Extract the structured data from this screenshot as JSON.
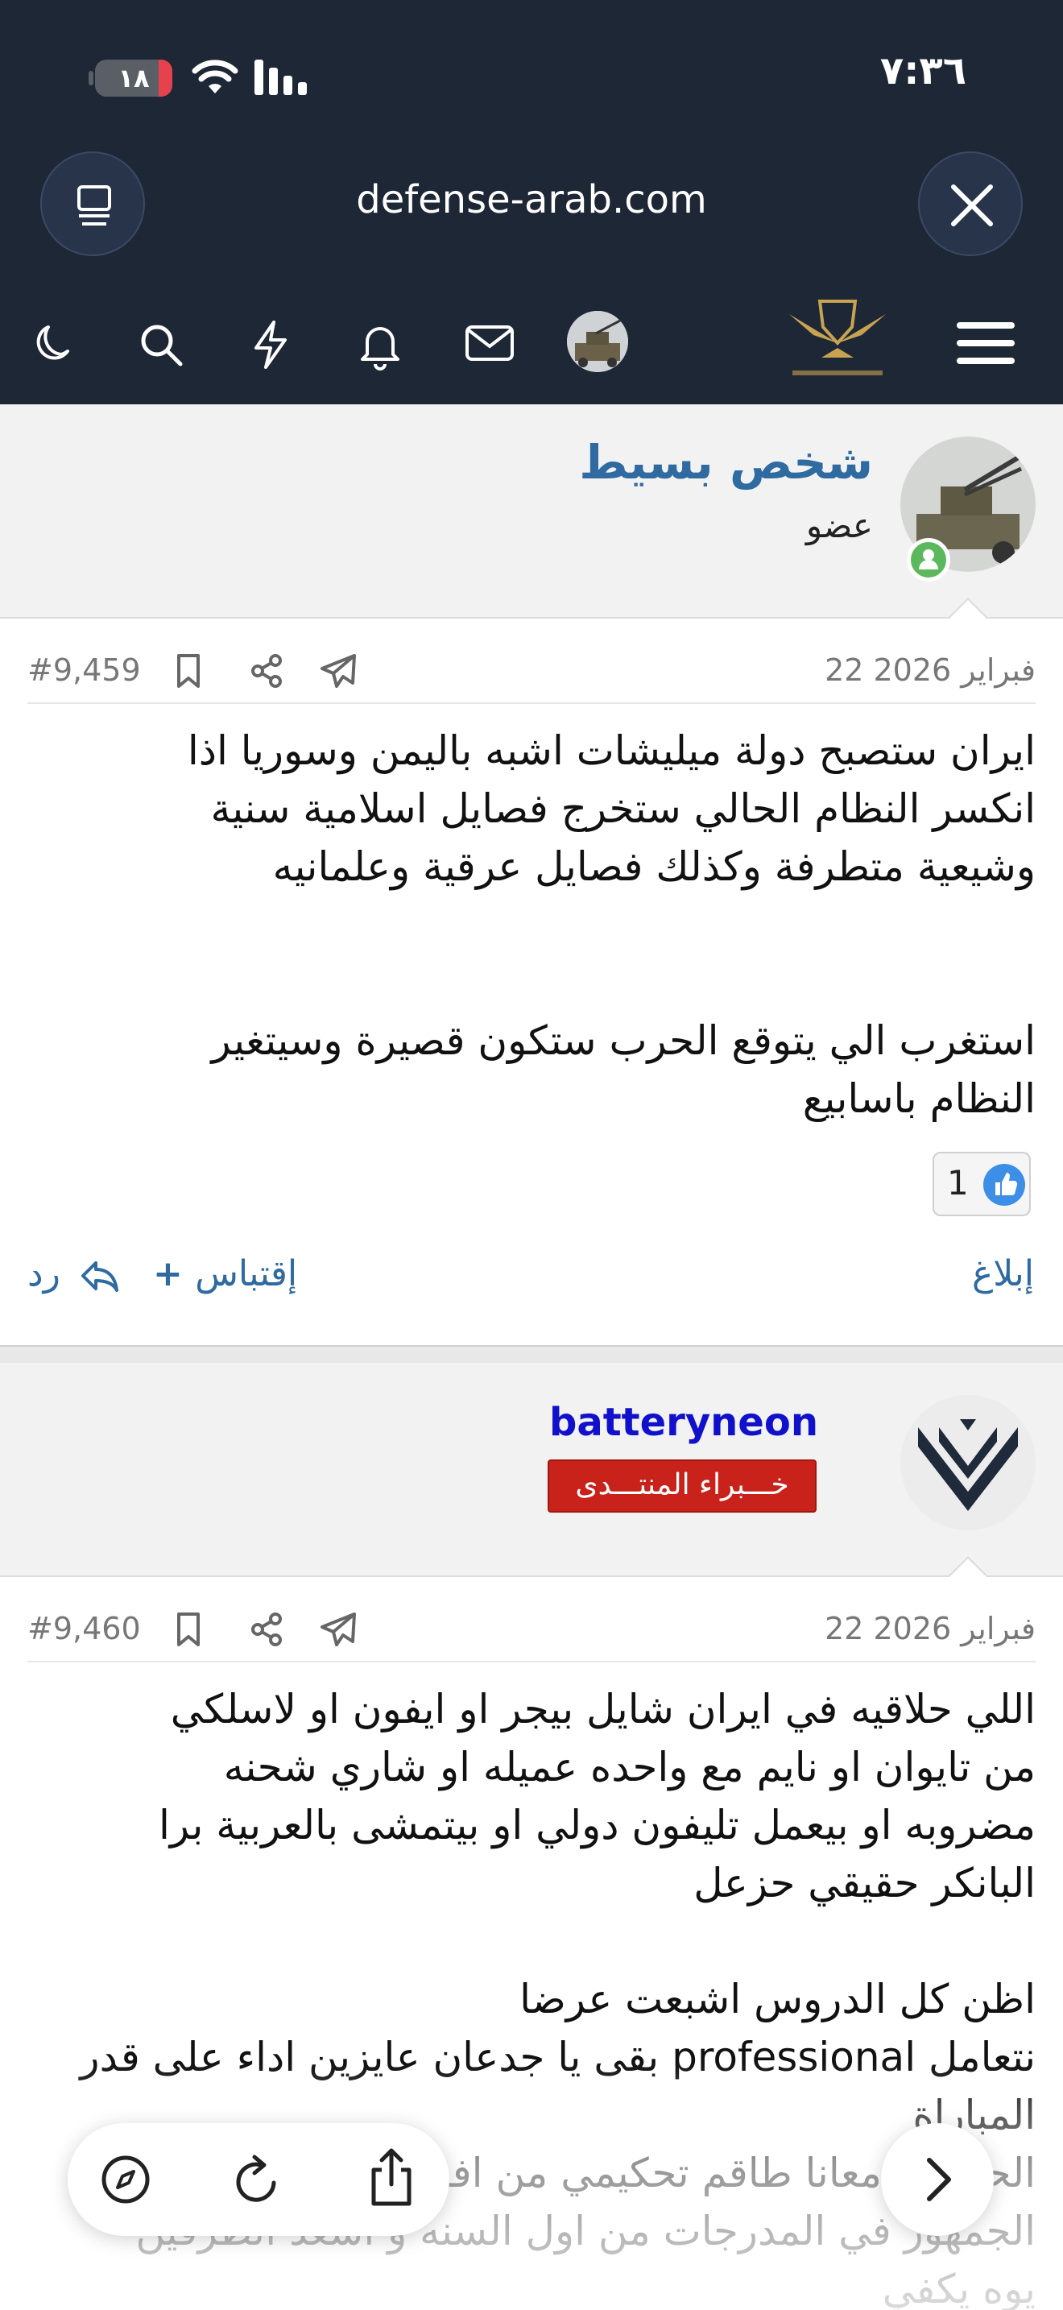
{
  "status": {
    "time": "٧:٣٦",
    "battery": "١٨",
    "battery_level": 0.18
  },
  "browser": {
    "url": "defense-arab.com"
  },
  "nav": {
    "icons": [
      "menu-icon",
      "site-logo",
      "user-avatar",
      "mail-icon",
      "bell-icon",
      "bolt-icon",
      "search-icon",
      "moon-icon"
    ]
  },
  "posts": [
    {
      "username": "شخص بسيط",
      "role": "عضو",
      "date": "22 فبراير 2026",
      "number": "#9,459",
      "body": "ايران ستصبح دولة ميليشات اشبه باليمن وسوريا اذا\nانكسر النظام الحالي ستخرج فصايل اسلامية سنية\nوشيعية متطرفة وكذلك فصايل عرقية وعلمانيه\n\n\nاستغرب الي يتوقع الحرب ستكون قصيرة وسيتغير\nالنظام باسابيع",
      "likes": "1",
      "report": "إبلاغ",
      "quote": "إقتباس",
      "reply": "رد"
    },
    {
      "username": "batteryneon",
      "role": "خـــبراء المنتـــدى",
      "date": "22 فبراير 2026",
      "number": "#9,460",
      "body": "اللي حلاقيه في ايران شايل بيجر او ايفون او لاسلكي\nمن تايوان او نايم مع واحده عميله او شاري شحنه\nمضروبه او بيعمل تليفون دولي او بيتمشى بالعربية برا\nالبانكر حقيقي حزعل\n\nاظن كل الدروس اشبعت عرضا\nنتعامل professional بقى يا جدعان عايزين اداء على قدر\nالمباراة\nالحمدلله معانا طاقم تحكيمي من افضل الحكام وايضا\nالجمهور في المدرجات من اول السنه و اسعد الطرفين\nيوه يكفي"
    }
  ],
  "toolbar": {
    "icons": [
      "compass-icon",
      "reload-icon",
      "share-icon",
      "forward-icon"
    ]
  }
}
